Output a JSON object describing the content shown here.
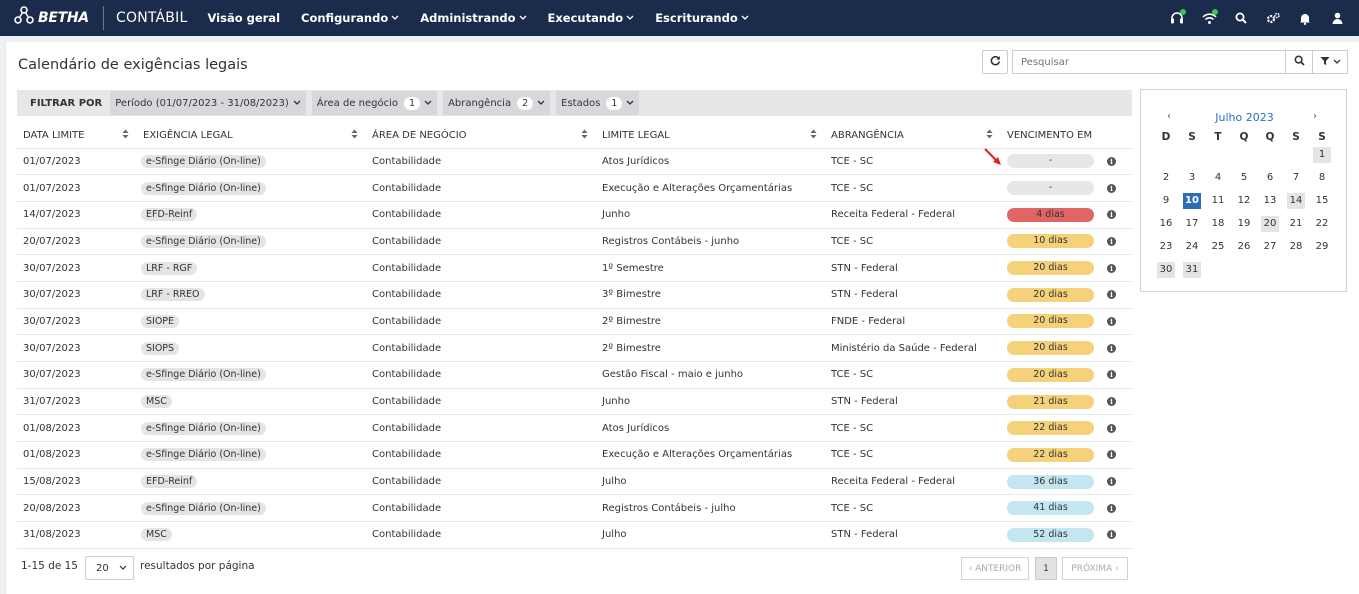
{
  "header": {
    "brand": "BETHA",
    "product": "CONTÁBIL",
    "nav": [
      "Visão geral",
      "Configurando",
      "Administrando",
      "Executando",
      "Escriturando"
    ],
    "nav_has_dropdown": [
      false,
      true,
      true,
      true,
      true
    ],
    "icons": [
      "headset-icon",
      "wifi-icon",
      "search-icon",
      "gears-icon",
      "bell-icon",
      "user-icon"
    ],
    "status_color": "#3fc64a"
  },
  "page": {
    "title": "Calendário de exigências legais",
    "search_placeholder": "Pesquisar"
  },
  "filters": {
    "label": "FILTRAR POR",
    "chips": [
      {
        "label": "Período (01/07/2023 - 31/08/2023)",
        "count": ""
      },
      {
        "label": "Área de negócio",
        "count": "1"
      },
      {
        "label": "Abrangência",
        "count": "2"
      },
      {
        "label": "Estados",
        "count": "1"
      }
    ]
  },
  "table": {
    "columns": [
      "DATA LIMITE",
      "EXIGÊNCIA LEGAL",
      "ÁREA DE NEGÓCIO",
      "LIMITE LEGAL",
      "ABRANGÊNCIA",
      "VENCIMENTO EM"
    ],
    "rows": [
      {
        "date": "01/07/2023",
        "requirement": "e-Sfinge Diário (On-line)",
        "area": "Contabilidade",
        "limit": "Atos Jurídicos",
        "scope": "TCE - SC",
        "due": "-",
        "status": "none"
      },
      {
        "date": "01/07/2023",
        "requirement": "e-Sfinge Diário (On-line)",
        "area": "Contabilidade",
        "limit": "Execução e Alterações Orçamentárias",
        "scope": "TCE - SC",
        "due": "-",
        "status": "none"
      },
      {
        "date": "14/07/2023",
        "requirement": "EFD-Reinf",
        "area": "Contabilidade",
        "limit": "Junho",
        "scope": "Receita Federal - Federal",
        "due": "4 dias",
        "status": "danger"
      },
      {
        "date": "20/07/2023",
        "requirement": "e-Sfinge Diário (On-line)",
        "area": "Contabilidade",
        "limit": "Registros Contábeis - junho",
        "scope": "TCE - SC",
        "due": "10 dias",
        "status": "warning"
      },
      {
        "date": "30/07/2023",
        "requirement": "LRF - RGF",
        "area": "Contabilidade",
        "limit": "1º Semestre",
        "scope": "STN - Federal",
        "due": "20 dias",
        "status": "warning"
      },
      {
        "date": "30/07/2023",
        "requirement": "LRF - RREO",
        "area": "Contabilidade",
        "limit": "3º Bimestre",
        "scope": "STN - Federal",
        "due": "20 dias",
        "status": "warning"
      },
      {
        "date": "30/07/2023",
        "requirement": "SIOPE",
        "area": "Contabilidade",
        "limit": "2º Bimestre",
        "scope": "FNDE - Federal",
        "due": "20 dias",
        "status": "warning"
      },
      {
        "date": "30/07/2023",
        "requirement": "SIOPS",
        "area": "Contabilidade",
        "limit": "2º Bimestre",
        "scope": "Ministério da Saúde - Federal",
        "due": "20 dias",
        "status": "warning"
      },
      {
        "date": "30/07/2023",
        "requirement": "e-Sfinge Diário (On-line)",
        "area": "Contabilidade",
        "limit": "Gestão Fiscal - maio e junho",
        "scope": "TCE - SC",
        "due": "20 dias",
        "status": "warning"
      },
      {
        "date": "31/07/2023",
        "requirement": "MSC",
        "area": "Contabilidade",
        "limit": "Junho",
        "scope": "STN - Federal",
        "due": "21 dias",
        "status": "warning"
      },
      {
        "date": "01/08/2023",
        "requirement": "e-Sfinge Diário (On-line)",
        "area": "Contabilidade",
        "limit": "Atos Jurídicos",
        "scope": "TCE - SC",
        "due": "22 dias",
        "status": "warning"
      },
      {
        "date": "01/08/2023",
        "requirement": "e-Sfinge Diário (On-line)",
        "area": "Contabilidade",
        "limit": "Execução e Alterações Orçamentárias",
        "scope": "TCE - SC",
        "due": "22 dias",
        "status": "warning"
      },
      {
        "date": "15/08/2023",
        "requirement": "EFD-Reinf",
        "area": "Contabilidade",
        "limit": "Julho",
        "scope": "Receita Federal - Federal",
        "due": "36 dias",
        "status": "info"
      },
      {
        "date": "20/08/2023",
        "requirement": "e-Sfinge Diário (On-line)",
        "area": "Contabilidade",
        "limit": "Registros Contábeis - julho",
        "scope": "TCE - SC",
        "due": "41 dias",
        "status": "info"
      },
      {
        "date": "31/08/2023",
        "requirement": "MSC",
        "area": "Contabilidade",
        "limit": "Julho",
        "scope": "STN - Federal",
        "due": "52 dias",
        "status": "info"
      }
    ],
    "status_colors": {
      "none": "#e6e7e9",
      "danger": "#e06666",
      "warning": "#f5d27a",
      "info": "#c4e6f0"
    }
  },
  "pagination": {
    "range": "1-15 de 15",
    "per_page": "20",
    "per_page_label": "resultados por página",
    "prev": "‹ ANTERIOR",
    "current": "1",
    "next": "PRÓXIMA ›"
  },
  "calendar": {
    "month": "Julho 2023",
    "weekdays": [
      "D",
      "S",
      "T",
      "Q",
      "Q",
      "S",
      "S"
    ],
    "first_weekday": 6,
    "days_in_month": 31,
    "selected": 10,
    "highlighted": [
      1,
      14,
      20,
      30,
      31
    ]
  },
  "annotation": {
    "arrow_color": "#e02020"
  }
}
